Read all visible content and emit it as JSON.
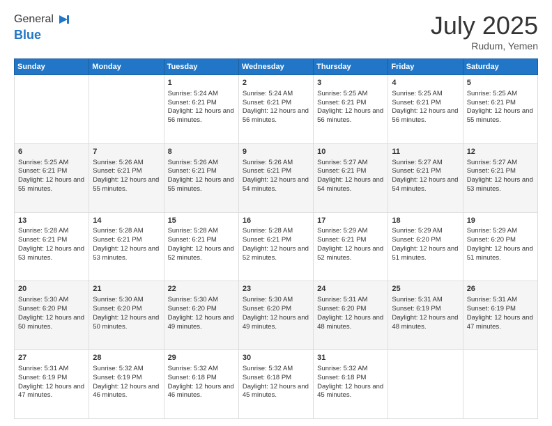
{
  "logo": {
    "general": "General",
    "blue": "Blue"
  },
  "header": {
    "month": "July 2025",
    "location": "Rudum, Yemen"
  },
  "weekdays": [
    "Sunday",
    "Monday",
    "Tuesday",
    "Wednesday",
    "Thursday",
    "Friday",
    "Saturday"
  ],
  "weeks": [
    [
      {
        "day": null,
        "text": ""
      },
      {
        "day": null,
        "text": ""
      },
      {
        "day": "1",
        "sunrise": "Sunrise: 5:24 AM",
        "sunset": "Sunset: 6:21 PM",
        "daylight": "Daylight: 12 hours and 56 minutes."
      },
      {
        "day": "2",
        "sunrise": "Sunrise: 5:24 AM",
        "sunset": "Sunset: 6:21 PM",
        "daylight": "Daylight: 12 hours and 56 minutes."
      },
      {
        "day": "3",
        "sunrise": "Sunrise: 5:25 AM",
        "sunset": "Sunset: 6:21 PM",
        "daylight": "Daylight: 12 hours and 56 minutes."
      },
      {
        "day": "4",
        "sunrise": "Sunrise: 5:25 AM",
        "sunset": "Sunset: 6:21 PM",
        "daylight": "Daylight: 12 hours and 56 minutes."
      },
      {
        "day": "5",
        "sunrise": "Sunrise: 5:25 AM",
        "sunset": "Sunset: 6:21 PM",
        "daylight": "Daylight: 12 hours and 55 minutes."
      }
    ],
    [
      {
        "day": "6",
        "sunrise": "Sunrise: 5:25 AM",
        "sunset": "Sunset: 6:21 PM",
        "daylight": "Daylight: 12 hours and 55 minutes."
      },
      {
        "day": "7",
        "sunrise": "Sunrise: 5:26 AM",
        "sunset": "Sunset: 6:21 PM",
        "daylight": "Daylight: 12 hours and 55 minutes."
      },
      {
        "day": "8",
        "sunrise": "Sunrise: 5:26 AM",
        "sunset": "Sunset: 6:21 PM",
        "daylight": "Daylight: 12 hours and 55 minutes."
      },
      {
        "day": "9",
        "sunrise": "Sunrise: 5:26 AM",
        "sunset": "Sunset: 6:21 PM",
        "daylight": "Daylight: 12 hours and 54 minutes."
      },
      {
        "day": "10",
        "sunrise": "Sunrise: 5:27 AM",
        "sunset": "Sunset: 6:21 PM",
        "daylight": "Daylight: 12 hours and 54 minutes."
      },
      {
        "day": "11",
        "sunrise": "Sunrise: 5:27 AM",
        "sunset": "Sunset: 6:21 PM",
        "daylight": "Daylight: 12 hours and 54 minutes."
      },
      {
        "day": "12",
        "sunrise": "Sunrise: 5:27 AM",
        "sunset": "Sunset: 6:21 PM",
        "daylight": "Daylight: 12 hours and 53 minutes."
      }
    ],
    [
      {
        "day": "13",
        "sunrise": "Sunrise: 5:28 AM",
        "sunset": "Sunset: 6:21 PM",
        "daylight": "Daylight: 12 hours and 53 minutes."
      },
      {
        "day": "14",
        "sunrise": "Sunrise: 5:28 AM",
        "sunset": "Sunset: 6:21 PM",
        "daylight": "Daylight: 12 hours and 53 minutes."
      },
      {
        "day": "15",
        "sunrise": "Sunrise: 5:28 AM",
        "sunset": "Sunset: 6:21 PM",
        "daylight": "Daylight: 12 hours and 52 minutes."
      },
      {
        "day": "16",
        "sunrise": "Sunrise: 5:28 AM",
        "sunset": "Sunset: 6:21 PM",
        "daylight": "Daylight: 12 hours and 52 minutes."
      },
      {
        "day": "17",
        "sunrise": "Sunrise: 5:29 AM",
        "sunset": "Sunset: 6:21 PM",
        "daylight": "Daylight: 12 hours and 52 minutes."
      },
      {
        "day": "18",
        "sunrise": "Sunrise: 5:29 AM",
        "sunset": "Sunset: 6:20 PM",
        "daylight": "Daylight: 12 hours and 51 minutes."
      },
      {
        "day": "19",
        "sunrise": "Sunrise: 5:29 AM",
        "sunset": "Sunset: 6:20 PM",
        "daylight": "Daylight: 12 hours and 51 minutes."
      }
    ],
    [
      {
        "day": "20",
        "sunrise": "Sunrise: 5:30 AM",
        "sunset": "Sunset: 6:20 PM",
        "daylight": "Daylight: 12 hours and 50 minutes."
      },
      {
        "day": "21",
        "sunrise": "Sunrise: 5:30 AM",
        "sunset": "Sunset: 6:20 PM",
        "daylight": "Daylight: 12 hours and 50 minutes."
      },
      {
        "day": "22",
        "sunrise": "Sunrise: 5:30 AM",
        "sunset": "Sunset: 6:20 PM",
        "daylight": "Daylight: 12 hours and 49 minutes."
      },
      {
        "day": "23",
        "sunrise": "Sunrise: 5:30 AM",
        "sunset": "Sunset: 6:20 PM",
        "daylight": "Daylight: 12 hours and 49 minutes."
      },
      {
        "day": "24",
        "sunrise": "Sunrise: 5:31 AM",
        "sunset": "Sunset: 6:20 PM",
        "daylight": "Daylight: 12 hours and 48 minutes."
      },
      {
        "day": "25",
        "sunrise": "Sunrise: 5:31 AM",
        "sunset": "Sunset: 6:19 PM",
        "daylight": "Daylight: 12 hours and 48 minutes."
      },
      {
        "day": "26",
        "sunrise": "Sunrise: 5:31 AM",
        "sunset": "Sunset: 6:19 PM",
        "daylight": "Daylight: 12 hours and 47 minutes."
      }
    ],
    [
      {
        "day": "27",
        "sunrise": "Sunrise: 5:31 AM",
        "sunset": "Sunset: 6:19 PM",
        "daylight": "Daylight: 12 hours and 47 minutes."
      },
      {
        "day": "28",
        "sunrise": "Sunrise: 5:32 AM",
        "sunset": "Sunset: 6:19 PM",
        "daylight": "Daylight: 12 hours and 46 minutes."
      },
      {
        "day": "29",
        "sunrise": "Sunrise: 5:32 AM",
        "sunset": "Sunset: 6:18 PM",
        "daylight": "Daylight: 12 hours and 46 minutes."
      },
      {
        "day": "30",
        "sunrise": "Sunrise: 5:32 AM",
        "sunset": "Sunset: 6:18 PM",
        "daylight": "Daylight: 12 hours and 45 minutes."
      },
      {
        "day": "31",
        "sunrise": "Sunrise: 5:32 AM",
        "sunset": "Sunset: 6:18 PM",
        "daylight": "Daylight: 12 hours and 45 minutes."
      },
      {
        "day": null,
        "text": ""
      },
      {
        "day": null,
        "text": ""
      }
    ]
  ]
}
